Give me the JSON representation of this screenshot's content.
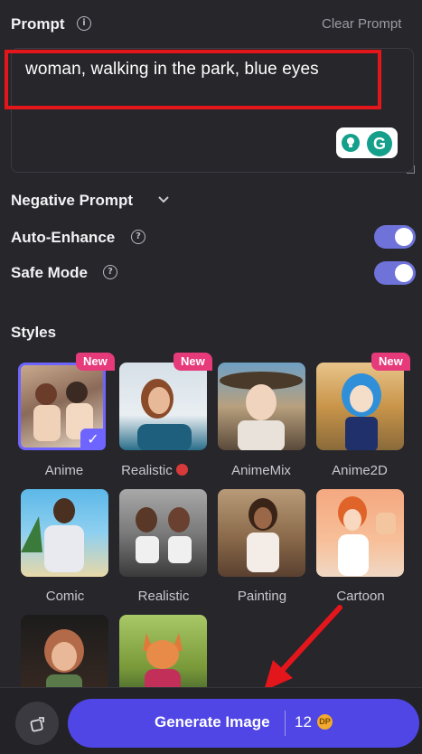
{
  "prompt": {
    "label": "Prompt",
    "clear_label": "Clear Prompt",
    "value": "woman, walking in the park, blue eyes"
  },
  "negative_prompt": {
    "label": "Negative Prompt"
  },
  "auto_enhance": {
    "label": "Auto-Enhance",
    "enabled": true
  },
  "safe_mode": {
    "label": "Safe Mode",
    "enabled": true
  },
  "styles": {
    "heading": "Styles",
    "new_badge": "New",
    "items": [
      {
        "label": "Anime",
        "new": true,
        "selected": true
      },
      {
        "label": "Realistic",
        "new": true,
        "selected": false
      },
      {
        "label": "AnimeMix",
        "new": false,
        "selected": false
      },
      {
        "label": "Anime2D",
        "new": true,
        "selected": false
      },
      {
        "label": "Comic",
        "new": false,
        "selected": false
      },
      {
        "label": "Realistic",
        "new": false,
        "selected": false
      },
      {
        "label": "Painting",
        "new": false,
        "selected": false
      },
      {
        "label": "Cartoon",
        "new": false,
        "selected": false
      },
      {
        "label": "",
        "new": false,
        "selected": false
      },
      {
        "label": "",
        "new": false,
        "selected": false
      }
    ]
  },
  "generate": {
    "label": "Generate Image",
    "count": "12"
  },
  "colors": {
    "accent": "#5046e5",
    "toggle": "#6f73d9",
    "badge": "#e63a7b",
    "annotation": "#e3161c"
  }
}
